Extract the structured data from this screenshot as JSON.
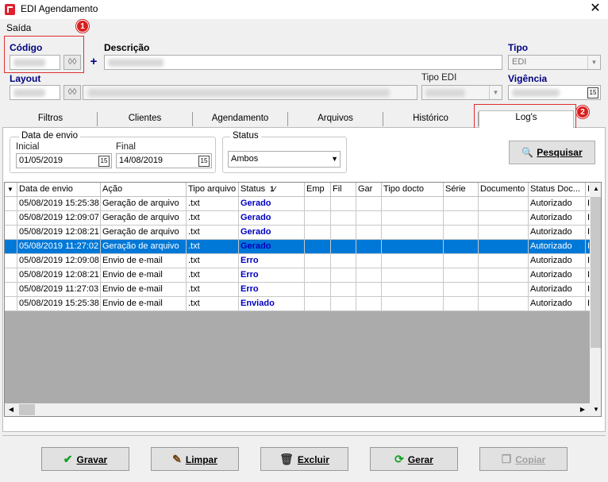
{
  "window": {
    "title": "EDI Agendamento",
    "close_glyph": "✕"
  },
  "menu": {
    "saida": "Saída"
  },
  "header": {
    "codigo_label": "Código",
    "descricao_label": "Descrição",
    "tipo_label": "Tipo",
    "tipo_value": "EDI",
    "layout_label": "Layout",
    "tipo_edi_label": "Tipo EDI",
    "vigencia_label": "Vigência",
    "add_glyph": "+"
  },
  "badges": {
    "one": "1",
    "two": "2"
  },
  "tabs": [
    "Filtros",
    "Clientes",
    "Agendamento",
    "Arquivos",
    "Histórico",
    "Log's"
  ],
  "filters": {
    "data_envio_title": "Data de envio",
    "inicial_label": "Inicial",
    "inicial_value": "01/05/2019",
    "final_label": "Final",
    "final_value": "14/08/2019",
    "status_title": "Status",
    "status_value": "Ambos",
    "pesquisar": "Pesquisar",
    "cal_glyph": "15"
  },
  "grid": {
    "columns": [
      "Data de envio",
      "Ação",
      "Tipo arquivo",
      "Status",
      "Emp",
      "Fil",
      "Gar",
      "Tipo docto",
      "Série",
      "Documento",
      "Status Doc...",
      "I"
    ],
    "sort_glyph": "1",
    "rows": [
      [
        "05/08/2019 15:25:38",
        "Geração de arquivo",
        ".txt",
        "Gerado",
        "",
        "",
        "",
        "",
        "",
        "",
        "Autorizado",
        "I"
      ],
      [
        "05/08/2019 12:09:07",
        "Geração de arquivo",
        ".txt",
        "Gerado",
        "",
        "",
        "",
        "",
        "",
        "",
        "Autorizado",
        "I"
      ],
      [
        "05/08/2019 12:08:21",
        "Geração de arquivo",
        ".txt",
        "Gerado",
        "",
        "",
        "",
        "",
        "",
        "",
        "Autorizado",
        "I"
      ],
      [
        "05/08/2019 11:27:02",
        "Geração de arquivo",
        ".txt",
        "Gerado",
        "",
        "",
        "",
        "",
        "",
        "",
        "Autorizado",
        "I"
      ],
      [
        "05/08/2019 12:09:08",
        "Envio de e-mail",
        ".txt",
        "Erro",
        "",
        "",
        "",
        "",
        "",
        "",
        "Autorizado",
        "I"
      ],
      [
        "05/08/2019 12:08:21",
        "Envio de e-mail",
        ".txt",
        "Erro",
        "",
        "",
        "",
        "",
        "",
        "",
        "Autorizado",
        "I"
      ],
      [
        "05/08/2019 11:27:03",
        "Envio de e-mail",
        ".txt",
        "Erro",
        "",
        "",
        "",
        "",
        "",
        "",
        "Autorizado",
        "I"
      ],
      [
        "05/08/2019 15:25:38",
        "Envio de e-mail",
        ".txt",
        "Enviado",
        "",
        "",
        "",
        "",
        "",
        "",
        "Autorizado",
        "I"
      ]
    ],
    "selected_row": 3
  },
  "buttons": {
    "gravar": "Gravar",
    "limpar": "Limpar",
    "excluir": "Excluir",
    "gerar": "Gerar",
    "copiar": "Copiar"
  }
}
